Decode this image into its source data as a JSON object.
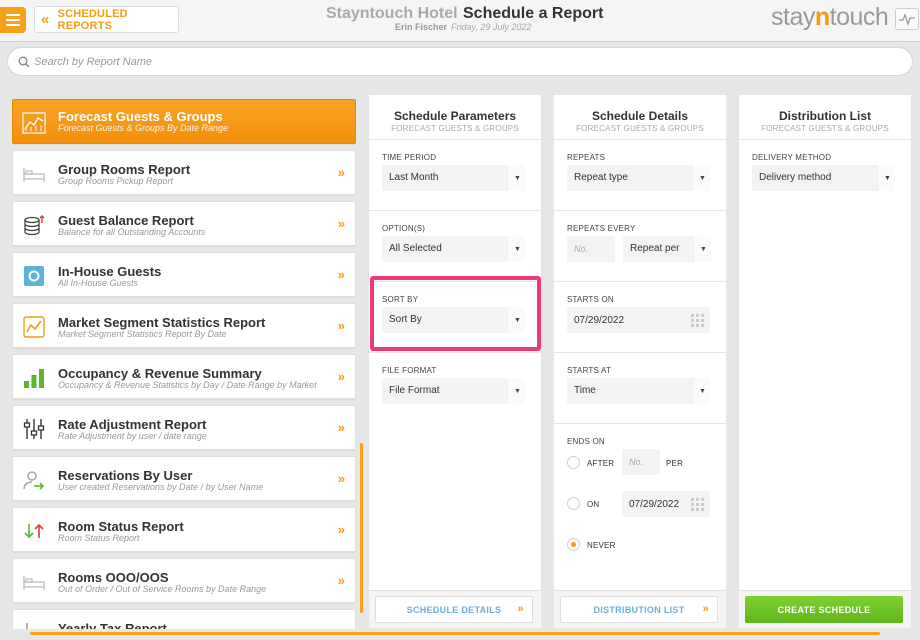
{
  "header": {
    "back_label": "SCHEDULED REPORTS",
    "hotel_name": "Stayntouch Hotel",
    "page_title": "Schedule a Report",
    "user_name": "Erin Fischer",
    "date": "Friday, 29 July 2022",
    "logo_part1": "stay",
    "logo_part2": "n",
    "logo_part3": "touch"
  },
  "search": {
    "placeholder": "Search by Report Name"
  },
  "reports": [
    {
      "title": "Forecast Guests & Groups",
      "subtitle": "Forecast Guests & Groups By Date Range",
      "icon": "forecast-chart-icon",
      "active": true
    },
    {
      "title": "Group Rooms Report",
      "subtitle": "Group Rooms Pickup Report",
      "icon": "bed-icon"
    },
    {
      "title": "Guest Balance Report",
      "subtitle": "Balance for all Outstanding Accounts",
      "icon": "coins-icon"
    },
    {
      "title": "In-House Guests",
      "subtitle": "All In-House Guests",
      "icon": "in-house-icon"
    },
    {
      "title": "Market Segment Statistics Report",
      "subtitle": "Market Segment Statistics Report By Date",
      "icon": "line-chart-icon"
    },
    {
      "title": "Occupancy & Revenue Summary",
      "subtitle": "Occupancy & Revenue Statistics by Day / Date Range by Market",
      "icon": "bar-chart-icon"
    },
    {
      "title": "Rate Adjustment Report",
      "subtitle": "Rate Adjustment by user / date range",
      "icon": "sliders-icon"
    },
    {
      "title": "Reservations By User",
      "subtitle": "User created Reservations by Date / by User Name",
      "icon": "user-arrow-icon"
    },
    {
      "title": "Room Status Report",
      "subtitle": "Room Status Report",
      "icon": "up-down-arrows-icon"
    },
    {
      "title": "Rooms OOO/OOS",
      "subtitle": "Out of Order / Out of Service Rooms by Date Range",
      "icon": "bed-icon"
    },
    {
      "title": "Yearly Tax Report",
      "subtitle": "",
      "icon": "tax-icon"
    }
  ],
  "report_arrow": "»",
  "schedule_parameters": {
    "title": "Schedule Parameters",
    "subtitle": "FORECAST GUESTS & GROUPS",
    "time_period_label": "TIME PERIOD",
    "time_period_value": "Last Month",
    "options_label": "OPTION(S)",
    "options_value": "All Selected",
    "sort_by_label": "SORT BY",
    "sort_by_value": "Sort By",
    "file_format_label": "FILE FORMAT",
    "file_format_value": "File Format",
    "footer_button": "SCHEDULE DETAILS"
  },
  "schedule_details": {
    "title": "Schedule Details",
    "subtitle": "FORECAST GUESTS & GROUPS",
    "repeats_label": "REPEATS",
    "repeats_value": "Repeat type",
    "repeats_every_label": "REPEATS EVERY",
    "repeats_every_placeholder": "No.",
    "repeat_per_value": "Repeat per",
    "starts_on_label": "STARTS ON",
    "starts_on_value": "07/29/2022",
    "starts_at_label": "STARTS AT",
    "starts_at_value": "Time",
    "ends_on_label": "ENDS ON",
    "after_label": "AFTER",
    "after_placeholder": "No.",
    "per_label": "PER",
    "on_label": "ON",
    "on_date_value": "07/29/2022",
    "never_label": "NEVER",
    "ends_on_selected": "NEVER",
    "footer_button": "DISTRIBUTION LIST"
  },
  "distribution_list": {
    "title": "Distribution List",
    "subtitle": "FORECAST GUESTS & GROUPS",
    "delivery_method_label": "DELIVERY METHOD",
    "delivery_method_value": "Delivery method",
    "create_button": "CREATE SCHEDULE"
  },
  "colors": {
    "accent": "#f39c12",
    "highlight": "#f0397a",
    "create_button": "#6cc223",
    "link_blue": "#6aafd8"
  }
}
